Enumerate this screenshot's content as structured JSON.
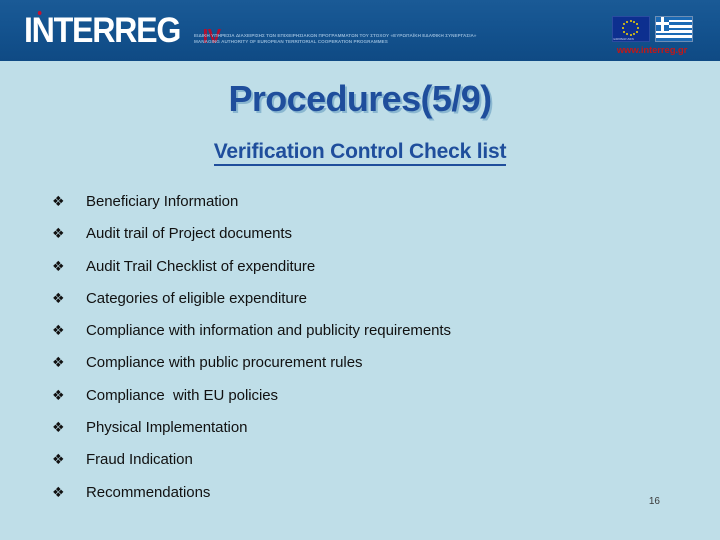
{
  "header": {
    "logo_text": "INTERREG",
    "logo_edition": "IV",
    "authority_line_gr": "ΕΙΔΙΚΗ ΥΠΗΡΕΣΙΑ ΔΙΑΧΕΙΡΙΣΗΣ ΤΩΝ ΕΠΙΧΕΙΡΗΣΙΑΚΩΝ ΠΡΟΓΡΑΜΜΑΤΩΝ ΤΟΥ ΣΤΟΧΟΥ «ΕΥΡΩΠΑΪΚΗ ΕΔΑΦΙΚΗ ΣΥΝΕΡΓΑΣΙΑ»",
    "authority_line_en": "MANAGING AUTHORITY OF EUROPEAN TERRITORIAL COOPERATION PROGRAMMES",
    "eu_flag_caption": "EUROPEAN UNION",
    "website": "www.interreg.gr",
    "band_color": "#14538f",
    "logo_accent_color": "#b01030",
    "website_color": "#c01818"
  },
  "slide": {
    "title": "Procedures(5/9)",
    "subtitle": "Verification Control Check list",
    "title_color": "#1f4e9c",
    "background_color": "#bfdee8",
    "page_number": "16",
    "bullet_glyph": "❖",
    "items": [
      {
        "label": "Beneficiary Information"
      },
      {
        "label": "Audit trail of Project documents"
      },
      {
        "label": "Audit Trail Checklist of expenditure"
      },
      {
        "label": "Categories of eligible expenditure"
      },
      {
        "label": "Compliance with information and publicity requirements"
      },
      {
        "label": "Compliance with public procurement rules"
      },
      {
        "label": "Compliance  with EU policies"
      },
      {
        "label": "Physical Implementation"
      },
      {
        "label": "Fraud Indication"
      },
      {
        "label": "Recommendations"
      }
    ]
  }
}
